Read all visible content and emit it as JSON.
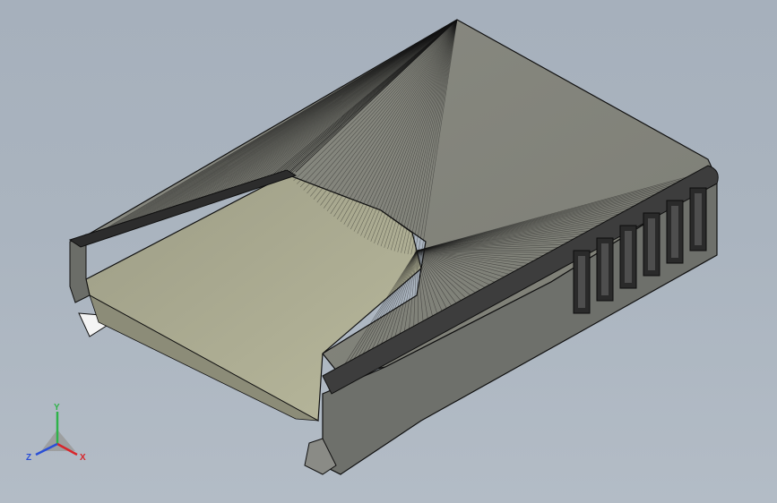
{
  "viewport": {
    "background_top": "#a6b0bc",
    "background_bottom": "#b3bcc6"
  },
  "model": {
    "shade_top": "#82837a",
    "shade_side": "#6f716c",
    "shade_inner": "#9a9a86",
    "shade_floor": "#b7b79d",
    "edge_color": "#101010"
  },
  "triad": {
    "x_label": "X",
    "y_label": "Y",
    "z_label": "Z",
    "x_color": "#d8262b",
    "y_color": "#2fb34a",
    "z_color": "#2a4fd6"
  }
}
